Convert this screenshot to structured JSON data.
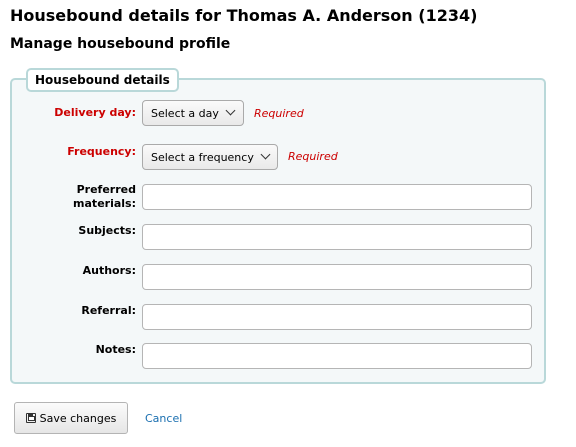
{
  "header": {
    "title": "Housebound details for Thomas A. Anderson (1234)",
    "subtitle": "Manage housebound profile"
  },
  "form": {
    "legend": "Housebound details",
    "required_text": "Required",
    "fields": {
      "delivery_day": {
        "label": "Delivery day:",
        "value": "Select a day",
        "required": true
      },
      "frequency": {
        "label": "Frequency:",
        "value": "Select a frequency",
        "required": true
      },
      "preferred_materials": {
        "label_line1": "Preferred",
        "label_line2": "materials:",
        "value": ""
      },
      "subjects": {
        "label": "Subjects:",
        "value": ""
      },
      "authors": {
        "label": "Authors:",
        "value": ""
      },
      "referral": {
        "label": "Referral:",
        "value": ""
      },
      "notes": {
        "label": "Notes:",
        "value": ""
      }
    }
  },
  "actions": {
    "save_label": "Save changes",
    "save_icon": "save-icon",
    "cancel_label": "Cancel"
  },
  "colors": {
    "required": "#cc0000",
    "fieldset_border": "#b9d8d9",
    "fieldset_bg": "#f4f8f9",
    "link": "#1a6fb0"
  }
}
